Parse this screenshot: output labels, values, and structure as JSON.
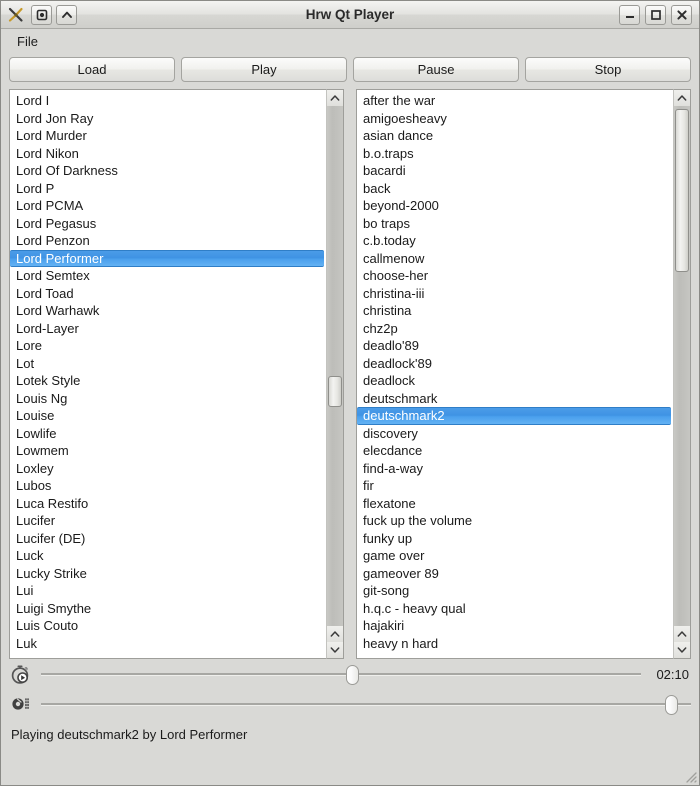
{
  "window": {
    "title": "Hrw Qt Player",
    "left_buttons": [
      {
        "name": "app-icon",
        "glyph": "app-logo-icon"
      },
      {
        "name": "sticky-button",
        "glyph": "sticky-icon"
      },
      {
        "name": "shade-button",
        "glyph": "chevron-up-icon"
      }
    ],
    "right_buttons": [
      {
        "name": "minimize-button",
        "glyph": "minimize-icon"
      },
      {
        "name": "maximize-button",
        "glyph": "maximize-icon"
      },
      {
        "name": "close-button",
        "glyph": "close-icon"
      }
    ]
  },
  "menubar": {
    "items": [
      {
        "label": "File"
      }
    ]
  },
  "toolbar": {
    "load_label": "Load",
    "play_label": "Play",
    "pause_label": "Pause",
    "stop_label": "Stop"
  },
  "artist_list": {
    "selected": "Lord Performer",
    "items": [
      "Lord I",
      "Lord Jon Ray",
      "Lord Murder",
      "Lord Nikon",
      "Lord Of Darkness",
      "Lord P",
      "Lord PCMA",
      "Lord Pegasus",
      "Lord Penzon",
      "Lord Performer",
      "Lord Semtex",
      "Lord Toad",
      "Lord Warhawk",
      "Lord-Layer",
      "Lore",
      "Lot",
      "Lotek Style",
      "Louis Ng",
      "Louise",
      "Lowlife",
      "Lowmem",
      "Loxley",
      "Lubos",
      "Luca Restifo",
      "Lucifer",
      "Lucifer (DE)",
      "Luck",
      "Lucky Strike",
      "Lui",
      "Luigi Smythe",
      "Luis Couto",
      "Luk"
    ]
  },
  "track_list": {
    "selected": "deutschmark2",
    "items": [
      "after the war",
      "amigoesheavy",
      "asian dance",
      "b.o.traps",
      "bacardi",
      "back",
      "beyond-2000",
      "bo traps",
      "c.b.today",
      "callmenow",
      "choose-her",
      "christina-iii",
      "christina",
      "chz2p",
      "deadlo'89",
      "deadlock'89",
      "deadlock",
      "deutschmark",
      "deutschmark2",
      "discovery",
      "elecdance",
      "find-a-way",
      "fir",
      "flexatone",
      "fuck up the volume",
      "funky up",
      "game over",
      "gameover 89",
      "git-song",
      "h.q.c - heavy qual",
      "hajakiri",
      "heavy n hard"
    ]
  },
  "position_slider": {
    "icon": "stopwatch-play-icon",
    "value_percent": 52,
    "time_label": "02:10"
  },
  "volume_slider": {
    "icon": "volume-icon",
    "value_percent": 98
  },
  "statusbar": {
    "text": "Playing deutschmark2 by Lord Performer"
  },
  "colors": {
    "selection_blue": "#4b9ce8",
    "window_bg": "#d9d9d6",
    "list_bg": "#ffffff"
  }
}
